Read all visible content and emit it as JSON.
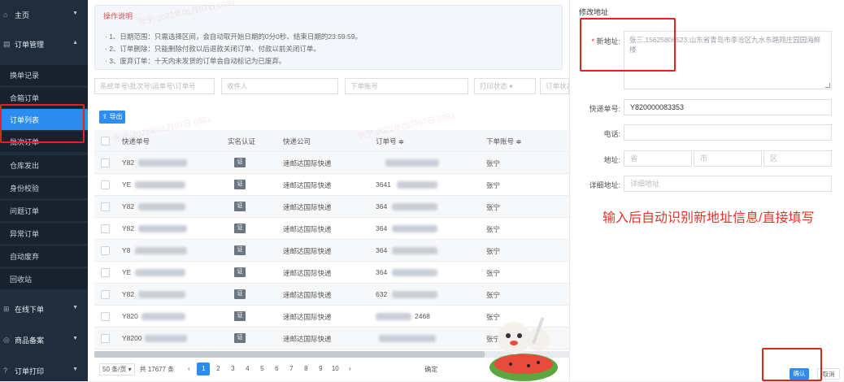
{
  "sidebar": {
    "groups": [
      {
        "label": "主页",
        "icon": "home-icon"
      },
      {
        "label": "订单管理",
        "icon": "order-icon"
      },
      {
        "label": "在线下单",
        "icon": "cart-icon"
      },
      {
        "label": "商品备案",
        "icon": "goods-icon"
      },
      {
        "label": "订单打印",
        "icon": "print-icon"
      }
    ],
    "items": [
      "换单记录",
      "合箱订单",
      "订单列表",
      "批次订单",
      "仓库发出",
      "身份校验",
      "问题订单",
      "异常订单",
      "自动废弃",
      "回收站"
    ]
  },
  "notice": {
    "title": "操作说明",
    "lines": [
      "· 1、日期范围：只需选择区间，会自动取开始日期的0分0秒、结束日期的23:59:59。",
      "· 2、订单删除：只能删除付款以后退款关闭订单、付款以前关闭订单。",
      "· 3、废弃订单：十天内未发货的订单会自动标记为已废弃。"
    ]
  },
  "filters": {
    "search_placeholder": "系统单号\\批次号\\运单号\\订单号",
    "receiver_placeholder": "收件人",
    "account_placeholder": "下单账号",
    "print_status": "打印状态",
    "order_status": "订单状态"
  },
  "toolbar": {
    "export_label": "导出"
  },
  "table": {
    "headers": [
      "快递单号",
      "实名认证",
      "快递公司",
      "订单号 ≑",
      "下单账号 ≑"
    ],
    "rows": [
      {
        "tracking": "Y82",
        "verified": "证",
        "carrier": "速邮达国际快递",
        "order": "",
        "account": "张宁"
      },
      {
        "tracking": "YE",
        "verified": "证",
        "carrier": "速邮达国际快递",
        "order": "3641",
        "account": "张宁"
      },
      {
        "tracking": "Y82",
        "verified": "证",
        "carrier": "速邮达国际快递",
        "order": "364",
        "account": "张宁"
      },
      {
        "tracking": "Y82",
        "verified": "证",
        "carrier": "速邮达国际快递",
        "order": "364",
        "account": "张宁"
      },
      {
        "tracking": "Y8",
        "verified": "证",
        "carrier": "速邮达国际快递",
        "order": "364",
        "account": "张宁"
      },
      {
        "tracking": "YE",
        "verified": "证",
        "carrier": "速邮达国际快递",
        "order": "364",
        "account": "张宁"
      },
      {
        "tracking": "Y82",
        "verified": "证",
        "carrier": "速邮达国际快递",
        "order": "632",
        "account": "张宁"
      },
      {
        "tracking": "Y820",
        "verified": "证",
        "carrier": "速邮达国际快递",
        "order": "2468",
        "account": "张宁"
      },
      {
        "tracking": "Y8200",
        "verified": "证",
        "carrier": "速邮达国际快递",
        "order": "",
        "account": "张宁"
      }
    ]
  },
  "pagination": {
    "page_size": "50 条/页 ▾",
    "total": "共 17677 条",
    "prev": "‹",
    "pages": [
      "1",
      "2",
      "3",
      "4",
      "5",
      "6",
      "7",
      "8",
      "9",
      "10"
    ],
    "next": "›",
    "goto": "确定"
  },
  "watermark": "张宁-2022年05月07日 0981",
  "panel": {
    "title": "修改地址",
    "new_address_label": "新地址:",
    "new_address_placeholder": "张三,15625806523,山东省青岛市李沧区九水东路翔庄园园海鲜楼",
    "tracking_label": "快递单号:",
    "tracking_value": "Y820000083353",
    "phone_label": "电话:",
    "address_label": "地址:",
    "province_placeholder": "省",
    "city_placeholder": "市",
    "district_placeholder": "区",
    "detail_label": "详细地址:",
    "detail_placeholder": "详细地址",
    "annotation": "输入后自动识别新地址信息/直接填写",
    "confirm": "确认",
    "cancel": "取消"
  },
  "colors": {
    "accent": "#2d8cf0",
    "highlight": "#e0251b",
    "sidebar": "#1f2d3d"
  }
}
